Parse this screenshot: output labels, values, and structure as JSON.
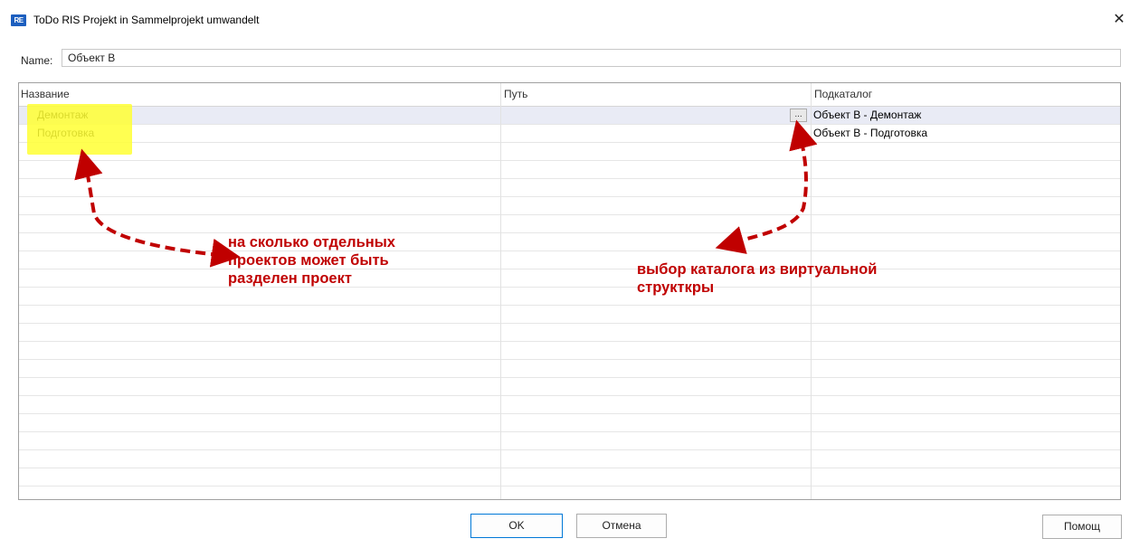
{
  "window": {
    "title": "ToDo RIS Projekt in Sammelprojekt umwandelt",
    "icon_label": "RE",
    "close_symbol": "✕"
  },
  "name_field": {
    "label": "Name:",
    "value": "Объект В"
  },
  "grid": {
    "columns": [
      "Название",
      "Путь",
      "Подкаталог"
    ],
    "rows": [
      {
        "name": "Демонтаж",
        "path": "",
        "subcatalog": "Объект В - Демонтаж",
        "selected": true,
        "browse_button": "..."
      },
      {
        "name": "Подготовка",
        "path": "",
        "subcatalog": "Объект В - Подготовка",
        "selected": false,
        "browse_button": ""
      }
    ]
  },
  "annotations": {
    "left": [
      "на сколько отдельных",
      "проектов может быть",
      "разделен проект"
    ],
    "right": [
      "выбор каталога из виртуальной",
      "структкры"
    ],
    "color": "#c00000",
    "highlight_color": "#ffff33"
  },
  "buttons": {
    "ok": "OK",
    "cancel": "Отмена",
    "help": "Помощ"
  }
}
